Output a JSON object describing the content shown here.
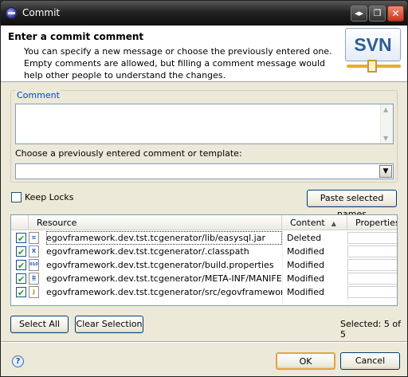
{
  "window": {
    "title": "Commit",
    "controls": {
      "restore": "◂▸",
      "maximize": "❐",
      "close": "✕"
    }
  },
  "header": {
    "title": "Enter a commit comment",
    "description": "You can specify a new message or choose the previously entered one. Empty comments are allowed, but filling a comment message would help other people to understand the changes.",
    "logo_text": "SVN"
  },
  "comment": {
    "group_label": "Comment",
    "value": "",
    "template_label": "Choose a previously entered comment or template:",
    "template_value": ""
  },
  "options": {
    "keep_locks_label": "Keep Locks",
    "keep_locks_checked": false,
    "paste_button": "Paste selected names"
  },
  "table": {
    "columns": [
      "Resource",
      "Content",
      "Properties"
    ],
    "sort_column": "Content",
    "rows": [
      {
        "checked": true,
        "icon": "jar-file-icon",
        "icon_glyph": "≡",
        "resource": "egovframework.dev.tst.tcgenerator/lib/easysql.jar",
        "content": "Deleted",
        "properties": ""
      },
      {
        "checked": true,
        "icon": "xml-file-icon",
        "icon_glyph": "X",
        "resource": "egovframework.dev.tst.tcgenerator/.classpath",
        "content": "Modified",
        "properties": ""
      },
      {
        "checked": true,
        "icon": "properties-file-icon",
        "icon_glyph": "010",
        "resource": "egovframework.dev.tst.tcgenerator/build.properties",
        "content": "Modified",
        "properties": ""
      },
      {
        "checked": true,
        "icon": "text-file-icon",
        "icon_glyph": "≣",
        "resource": "egovframework.dev.tst.tcgenerator/META-INF/MANIFEST...",
        "content": "Modified",
        "properties": ""
      },
      {
        "checked": true,
        "icon": "java-file-icon",
        "icon_glyph": "J",
        "resource": "egovframework.dev.tst.tcgenerator/src/egovframework/de...",
        "content": "Modified",
        "properties": ""
      }
    ]
  },
  "selection": {
    "select_all": "Select All",
    "clear_selection": "Clear Selection",
    "status": "Selected: 5 of 5"
  },
  "footer": {
    "help_glyph": "?",
    "ok": "OK",
    "cancel": "Cancel"
  }
}
